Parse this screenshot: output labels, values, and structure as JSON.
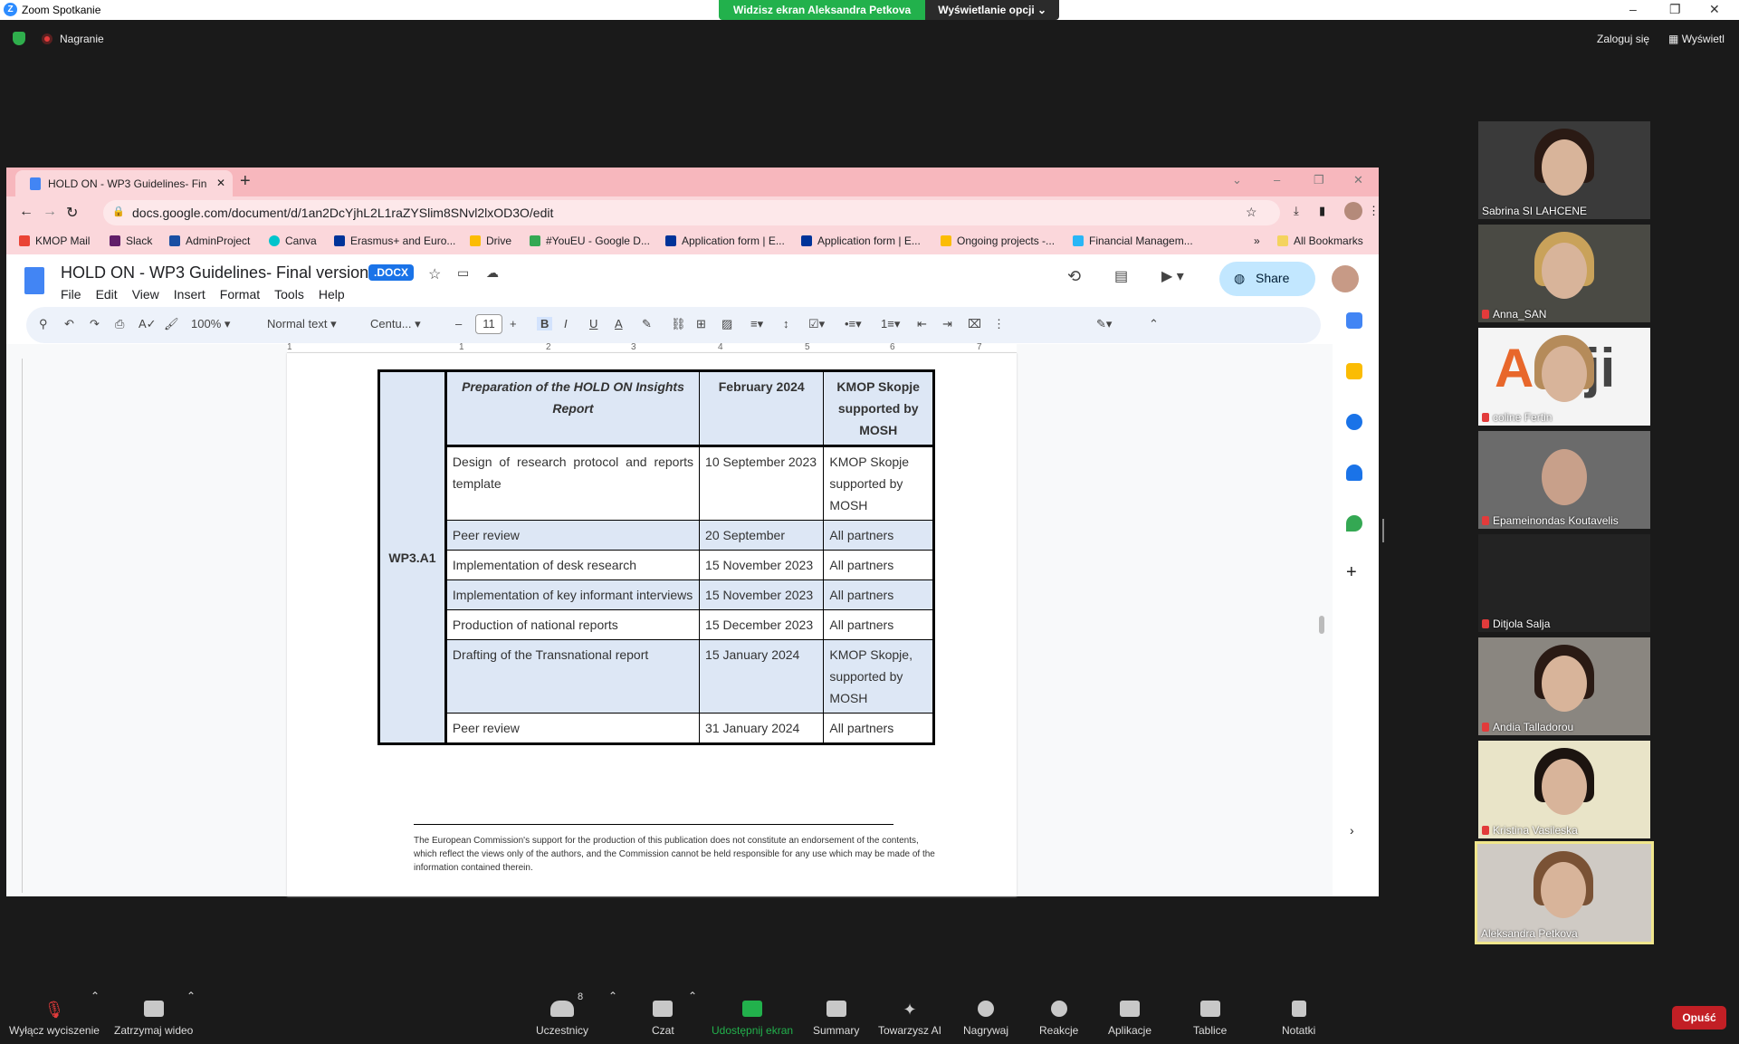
{
  "zoom": {
    "window_title": "Zoom Spotkanie",
    "share_banner": "Widzisz ekran Aleksandra Petkova",
    "view_options": "Wyświetlanie opcji",
    "recording_label": "Nagranie",
    "sign_in": "Zaloguj się",
    "view_label": "Wyświetl",
    "participant_count": "8",
    "bottom": {
      "mute": "Wyłącz wyciszenie",
      "video": "Zatrzymaj wideo",
      "participants": "Uczestnicy",
      "chat": "Czat",
      "share": "Udostępnij ekran",
      "summary": "Summary",
      "ai": "Towarzysz AI",
      "record": "Nagrywaj",
      "reactions": "Reakcje",
      "apps": "Aplikacje",
      "whiteboards": "Tablice",
      "notes": "Notatki",
      "leave": "Opuść"
    }
  },
  "browser": {
    "tab_title": "HOLD ON - WP3 Guidelines- Fin",
    "url": "docs.google.com/document/d/1an2DcYjhL2L1raZYSlim8SNvl2lxOD3O/edit",
    "bookmarks": [
      "KMOP Mail",
      "Slack",
      "AdminProject",
      "Canva",
      "Erasmus+ and Euro...",
      "Drive",
      "#YouEU - Google D...",
      "Application form | E...",
      "Application form | E...",
      "Ongoing projects -...",
      "Financial Managem..."
    ],
    "all_bookmarks": "All Bookmarks"
  },
  "doc": {
    "title": "HOLD ON - WP3 Guidelines- Final version",
    "badge": ".DOCX",
    "menus": [
      "File",
      "Edit",
      "View",
      "Insert",
      "Format",
      "Tools",
      "Help"
    ],
    "share": "Share",
    "zoom": "100%",
    "style": "Normal text",
    "font": "Centu...",
    "font_size": "11",
    "ruler": [
      "1",
      "1",
      "2",
      "3",
      "4",
      "5",
      "6",
      "7"
    ],
    "group_label": "WP3.A1",
    "header": {
      "activity": "Preparation of the HOLD ON Insights Report",
      "date": "February 2024",
      "resp": "KMOP Skopje supported by MOSH"
    },
    "rows": [
      {
        "activity": "Design of research protocol and reports template",
        "date": "10 September 2023",
        "resp": "KMOP Skopje supported by MOSH"
      },
      {
        "activity": "Peer review",
        "date": "20 September",
        "resp": "All partners"
      },
      {
        "activity": "Implementation of desk research",
        "date": "15 November 2023",
        "resp": "All partners"
      },
      {
        "activity": "Implementation of key informant interviews",
        "date": "15 November 2023",
        "resp": "All partners"
      },
      {
        "activity": "Production of national reports",
        "date": "15 December 2023",
        "resp": "All partners"
      },
      {
        "activity": "Drafting of the Transnational report",
        "date": "15 January 2024",
        "resp": "KMOP Skopje, supported by MOSH"
      },
      {
        "activity": "Peer review",
        "date": "31 January 2024",
        "resp": "All partners"
      }
    ],
    "footnote": "The European Commission's support for the production of this publication does not constitute an endorsement of the contents, which reflect the views only of the authors, and the Commission cannot be held responsible for any use which may be made of the information contained therein."
  },
  "participants": [
    {
      "name": "Sabrina SI LAHCENE",
      "muted": false
    },
    {
      "name": "Anna_SAN",
      "muted": true
    },
    {
      "name": "coline Fertin",
      "muted": true
    },
    {
      "name": "Epameinondas Koutavelis",
      "muted": true
    },
    {
      "name": "Ditjola Salja",
      "muted": true
    },
    {
      "name": "Andia Talladorou",
      "muted": true
    },
    {
      "name": "Kristina Vasileska",
      "muted": true
    },
    {
      "name": "Aleksandra Petkova",
      "muted": false
    }
  ],
  "colors": {
    "zoom_green": "#22b14c",
    "leave_red": "#c21f25",
    "chrome_pink": "#f7b7bd",
    "table_shade": "#dde7f5",
    "active_speaker": "#f0e68c"
  }
}
